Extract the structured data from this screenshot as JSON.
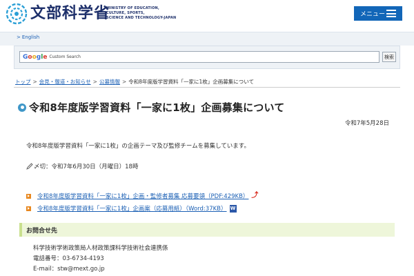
{
  "header": {
    "logo_text": "文部科学省",
    "ministry_en": [
      "MINISTRY OF EDUCATION,",
      "CULTURE, SPORTS,",
      "SCIENCE AND TECHNOLOGY-JAPAN"
    ],
    "menu_label": "メニュー",
    "logo_icon": "mext-logo-icon",
    "menu_icon": "hamburger-icon"
  },
  "topbar": {
    "english_label": "English"
  },
  "search": {
    "google_label": "Google",
    "placeholder": "Custom Search",
    "button_label": "検索"
  },
  "breadcrumb": {
    "items": [
      "トップ",
      "会見・報道・お知らせ",
      "公募情報"
    ],
    "current": "令和8年度版学習資料「一家に1枚」企画募集について",
    "separator": ">"
  },
  "page": {
    "title": "令和8年度版学習資料「一家に1枚」企画募集について",
    "date": "令和7年5月28日",
    "body": "令和8年度版学習資料「一家に1枚」の企画テーマ及び監修チームを募集しています。",
    "deadline": "〆切：令和7年6月30日（月曜日）18時",
    "links": [
      {
        "text": "令和8年度版学習資料「一家に1枚」企画・監修者募集 応募要領（PDF:429KB）",
        "icon": "pdf-icon"
      },
      {
        "text": "令和8年度版学習資料「一家に1枚」企画案（応募用紙）（Word:37KB）",
        "icon": "word-icon"
      }
    ]
  },
  "contact": {
    "heading": "お問合せ先",
    "lines": [
      "科学技術学術政策局人材政策課科学技術社会連携係",
      "電話番号：03-6734-4193",
      "E-mail：stw@mext.go.jp"
    ]
  },
  "colors": {
    "brand_navy": "#1d2f6a",
    "menu_blue": "#1266b8",
    "link_blue": "#1a5fb4",
    "bullet_orange": "#e8871e",
    "contact_bg": "#eef6da"
  }
}
